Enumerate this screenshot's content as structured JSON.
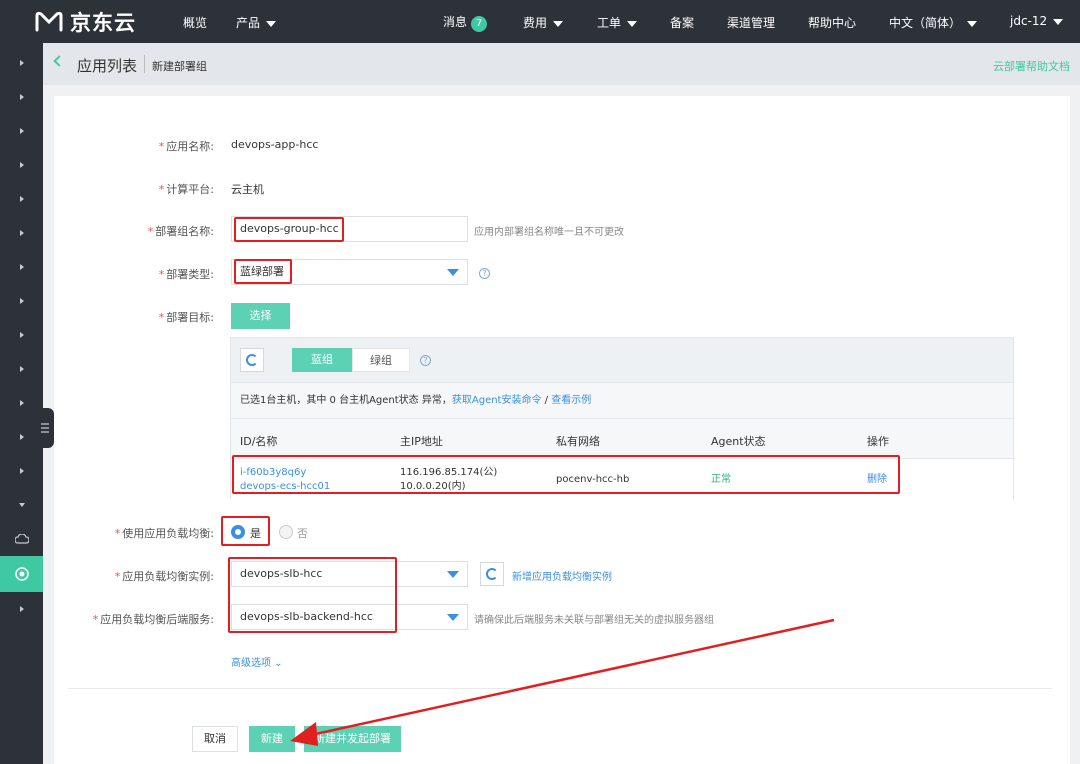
{
  "topnav": {
    "logo_text": "京东云",
    "overview": "概览",
    "products": "产品",
    "messages": "消息",
    "messages_count": "7",
    "billing": "费用",
    "tickets": "工单",
    "beian": "备案",
    "channel": "渠道管理",
    "help": "帮助中心",
    "language": "中文（简体）",
    "user": "jdc-12"
  },
  "breadcrumb": {
    "main": "应用列表",
    "sub": "新建部署组",
    "help_link": "云部署帮助文档"
  },
  "form": {
    "app_name_label": "应用名称:",
    "app_name_value": "devops-app-hcc",
    "platform_label": "计算平台:",
    "platform_value": "云主机",
    "group_name_label": "部署组名称:",
    "group_name_value": "devops-group-hcc",
    "group_name_hint": "应用内部署组名称唯一且不可更改",
    "deploy_type_label": "部署类型:",
    "deploy_type_value": "蓝绿部署",
    "target_label": "部署目标:",
    "select_button": "选择",
    "lb_use_label": "使用应用负载均衡:",
    "lb_yes": "是",
    "lb_no": "否",
    "lb_instance_label": "应用负载均衡实例:",
    "lb_instance_value": "devops-slb-hcc",
    "lb_new_link": "新增应用负载均衡实例",
    "lb_backend_label": "应用负载均衡后端服务:",
    "lb_backend_value": "devops-slb-backend-hcc",
    "lb_backend_hint": "请确保此后端服务未关联与部署组无关的虚拟服务器组",
    "advanced": "高级选项",
    "required_mark": "*"
  },
  "hosts": {
    "tab_blue": "蓝组",
    "tab_green": "绿组",
    "info_prefix": "已选1台主机，其中 0 台主机Agent状态 异常，",
    "info_link1": "获取Agent安装命令",
    "info_sep": " / ",
    "info_link2": "查看示例",
    "columns": [
      "ID/名称",
      "主IP地址",
      "私有网络",
      "Agent状态",
      "操作"
    ],
    "row": {
      "id": "i-f60b3y8q6y",
      "name": "devops-ecs-hcc01",
      "ip_public": "116.196.85.174(公)",
      "ip_private": "10.0.0.20(内)",
      "vpc": "pocenv-hcc-hb",
      "agent": "正常",
      "action": "删除"
    }
  },
  "footer": {
    "cancel": "取消",
    "create": "新建",
    "create_deploy": "新建并发起部署"
  },
  "colors": {
    "accent": "#5cd1b4",
    "link": "#3b8fe0",
    "annotation": "#e02020",
    "nav_bg": "#2d3239"
  }
}
